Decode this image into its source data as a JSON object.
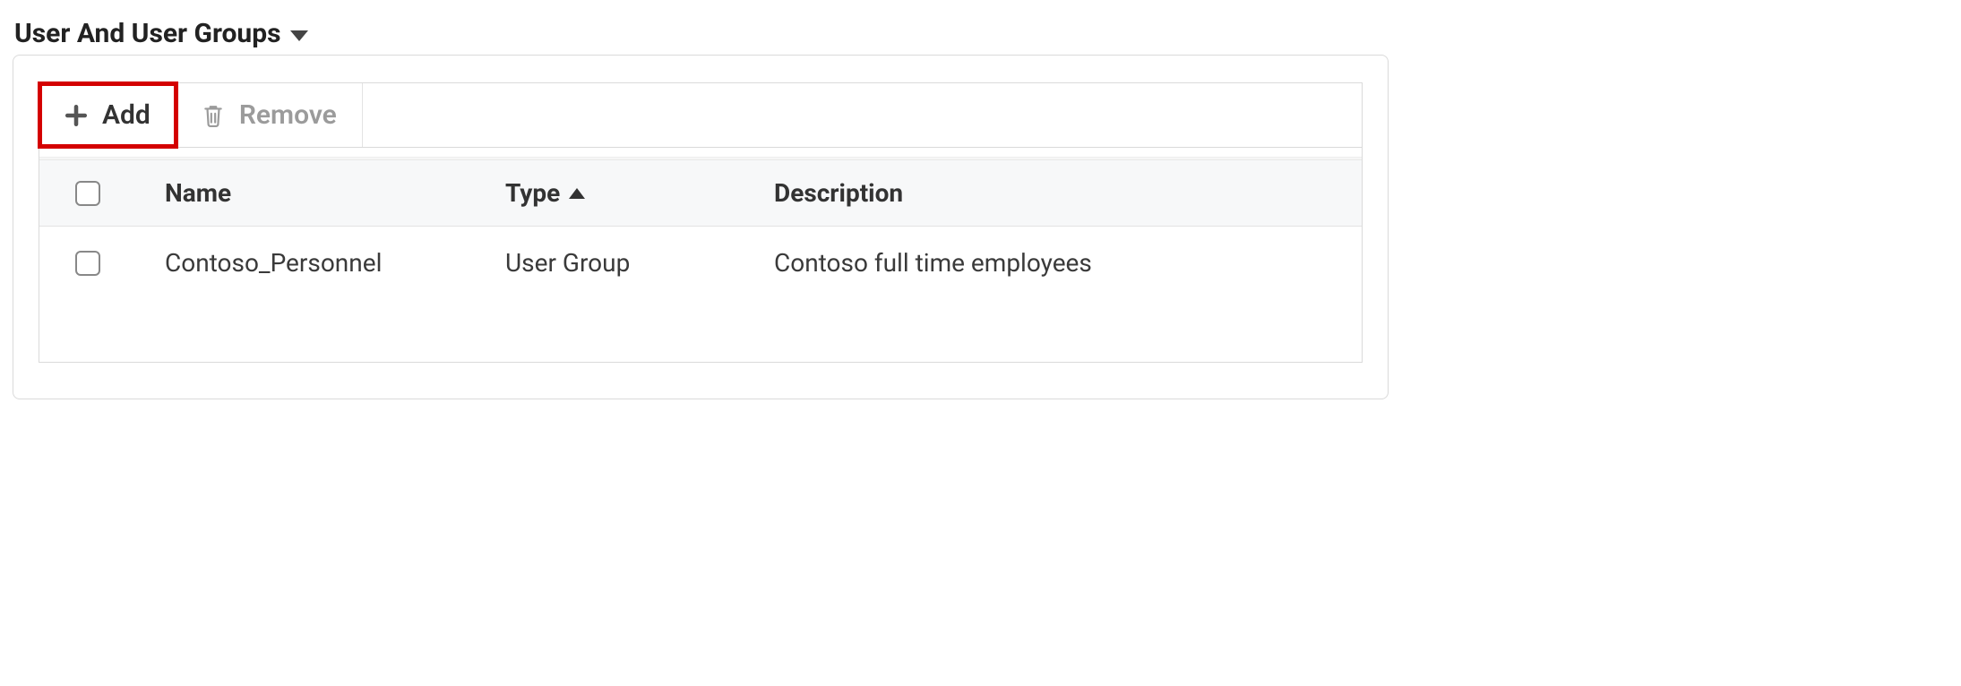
{
  "section": {
    "title": "User And User Groups"
  },
  "toolbar": {
    "add_label": "Add",
    "remove_label": "Remove"
  },
  "table": {
    "columns": {
      "name": "Name",
      "type": "Type",
      "description": "Description"
    },
    "sort": {
      "column": "type",
      "direction": "asc"
    },
    "rows": [
      {
        "name": "Contoso_Personnel",
        "type": "User Group",
        "description": "Contoso full time employees"
      }
    ]
  }
}
